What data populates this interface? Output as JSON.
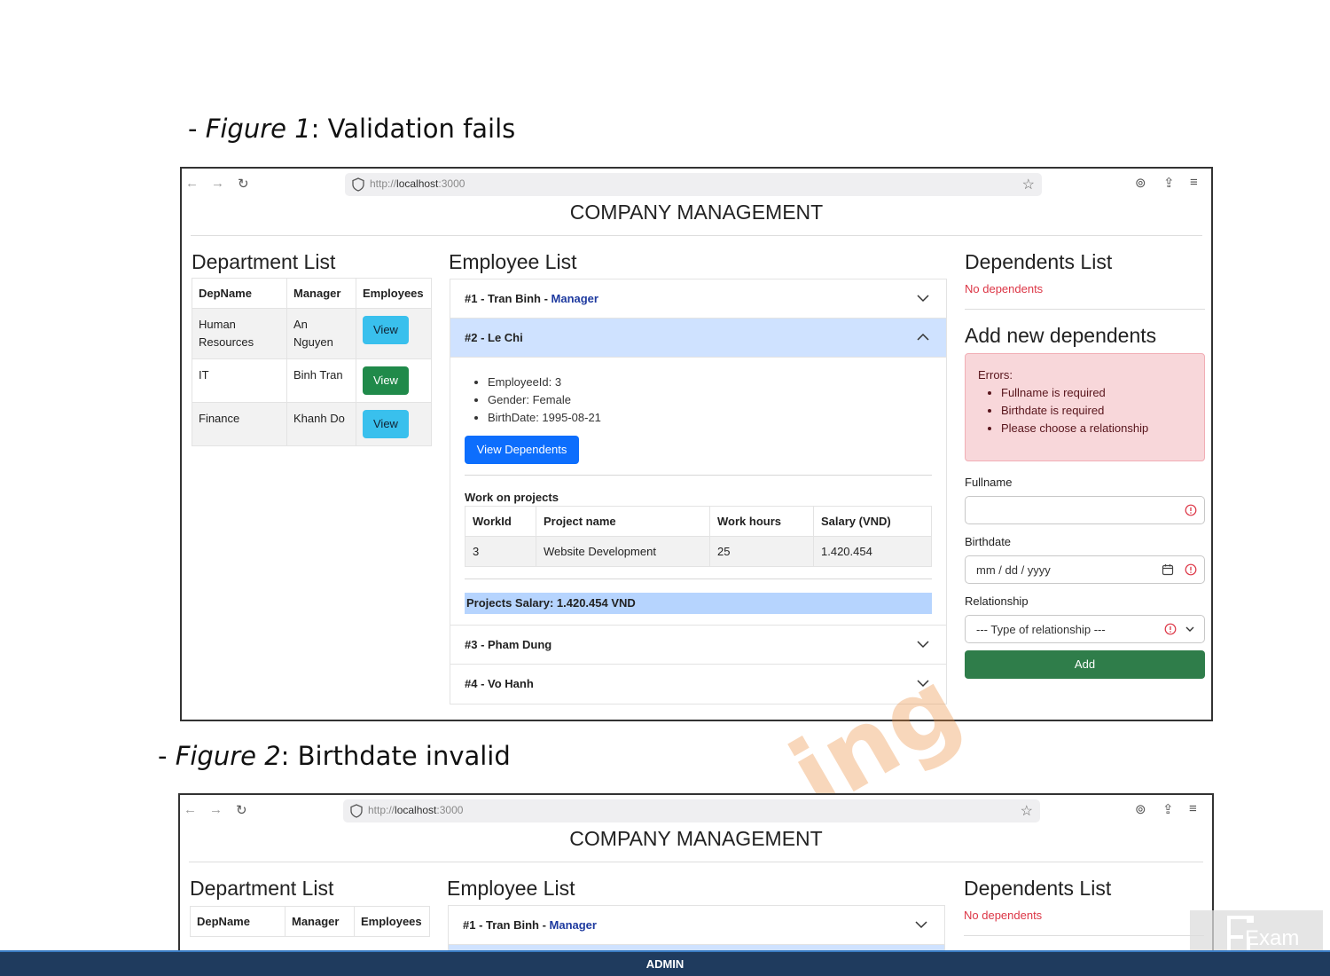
{
  "captions": {
    "fig1_prefix": "- ",
    "fig1_italic": "Figure 1",
    "fig1_rest": ": Validation fails",
    "fig2_prefix": "- ",
    "fig2_italic": "Figure 2",
    "fig2_rest": ": Birthdate invalid"
  },
  "browser": {
    "url_prefix": "http://",
    "url_host": "localhost",
    "url_port": ":3000",
    "back": "←",
    "forward": "→",
    "reload": "↻",
    "star": "☆",
    "account": "⊚",
    "extensions": "⇪",
    "menu": "≡"
  },
  "app": {
    "title": "COMPANY MANAGEMENT"
  },
  "department": {
    "heading": "Department List",
    "columns": [
      "DepName",
      "Manager",
      "Employees"
    ],
    "rows": [
      {
        "name": "Human Resources",
        "manager": "An Nguyen",
        "button": "View"
      },
      {
        "name": "IT",
        "manager": "Binh Tran",
        "button": "View"
      },
      {
        "name": "Finance",
        "manager": "Khanh Do",
        "button": "View"
      }
    ]
  },
  "employee": {
    "heading": "Employee List",
    "items": [
      {
        "label": "#1 - Tran Binh - ",
        "role": "Manager"
      },
      {
        "label": "#2 - Le Chi",
        "role": ""
      },
      {
        "label": "#3 - Pham Dung",
        "role": ""
      },
      {
        "label": "#4 - Vo Hanh",
        "role": ""
      }
    ],
    "details": [
      "EmployeeId: 3",
      "Gender: Female",
      "BirthDate: 1995-08-21"
    ],
    "view_dependents": "View Dependents",
    "work_heading": "Work on projects",
    "project_columns": [
      "WorkId",
      "Project name",
      "Work hours",
      "Salary (VND)"
    ],
    "projects": [
      {
        "workId": "3",
        "name": "Website Development",
        "hours": "25",
        "salary": "1.420.454"
      }
    ],
    "projects_salary": "Projects Salary: 1.420.454 VND"
  },
  "dependents": {
    "heading": "Dependents List",
    "empty": "No dependents",
    "add_heading": "Add new dependents",
    "errors_title": "Errors:",
    "errors": [
      "Fullname is required",
      "Birthdate is required",
      "Please choose a relationship"
    ],
    "fullname_label": "Fullname",
    "fullname_value": "",
    "birthdate_label": "Birthdate",
    "birthdate_placeholder": "mm / dd / yyyy",
    "relationship_label": "Relationship",
    "relationship_selected": "--- Type of relationship ---",
    "add_button": "Add"
  },
  "footer": {
    "text": "ADMIN"
  },
  "logo": {
    "text": "Exam"
  },
  "colors": {
    "primary": "#0d6efd",
    "info": "#39c0ed",
    "success": "#208a4a",
    "danger": "#dc3545",
    "accordion_open": "#cfe2ff",
    "footer": "#1f3b5e"
  }
}
